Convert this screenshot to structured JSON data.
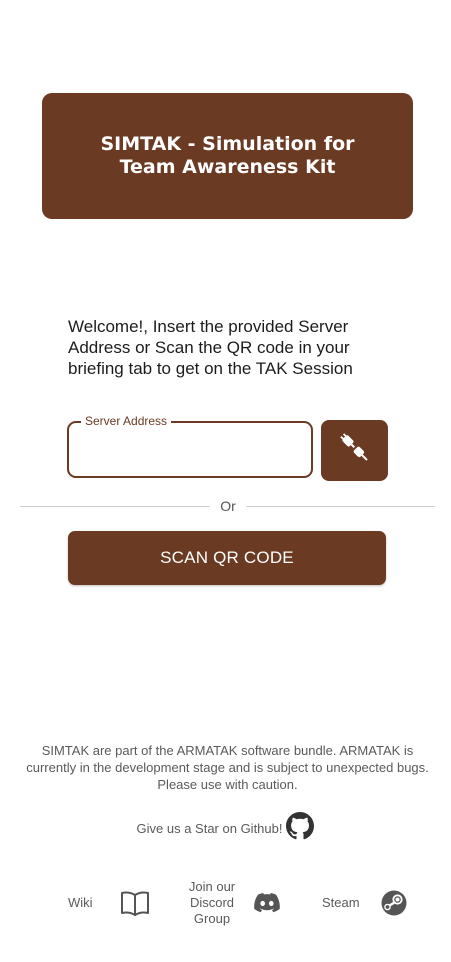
{
  "header": {
    "title": "SIMTAK - Simulation for Team Awareness Kit"
  },
  "welcome": {
    "message": "Welcome!, Insert the provided Server Address or Scan the QR code in your briefing tab to get on the TAK Session"
  },
  "server_field": {
    "label": "Server Address",
    "value": "",
    "placeholder": ""
  },
  "connect_button": {
    "icon": "plug-connect-icon"
  },
  "divider": {
    "label": "Or"
  },
  "scan_button": {
    "label": "SCAN QR CODE"
  },
  "disclaimer": {
    "text": "SIMTAK are part of the ARMATAK software bundle. ARMATAK is currently in the development stage and is subject to unexpected bugs. Please use with caution."
  },
  "github": {
    "label": "Give us a Star on Github!",
    "icon": "github-icon"
  },
  "footer": {
    "wiki_label": "Wiki",
    "discord_label": "Join our Discord Group",
    "steam_label": "Steam"
  },
  "colors": {
    "accent": "#6b3a22",
    "text_muted": "#5a5a5a",
    "divider": "#cfcfcf"
  }
}
